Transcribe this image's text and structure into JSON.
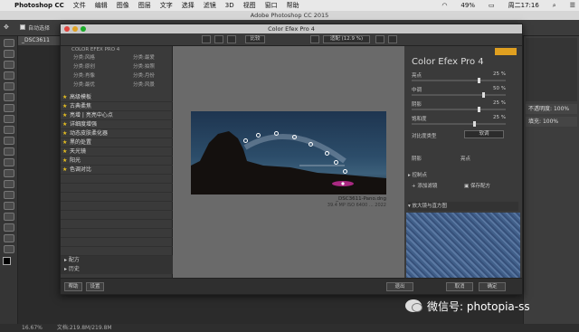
{
  "menubar": {
    "app_name": "Photoshop CC",
    "items": [
      "文件",
      "编辑",
      "图像",
      "图层",
      "文字",
      "选择",
      "滤镜",
      "3D",
      "视图",
      "窗口",
      "帮助"
    ],
    "battery": "49%",
    "clock": "周二17:16"
  },
  "ps_window": {
    "title": "Adobe Photoshop CC 2015",
    "auto_select_label": "自动选择",
    "doc_tab": "_DSC3611",
    "zoom_status": "16.67%",
    "doc_status": "文档:219.8M/219.8M"
  },
  "right_panels": {
    "opacity_label": "不透明度:",
    "opacity_value": "100%",
    "fill_label": "填充:",
    "fill_value": "100%"
  },
  "plugin": {
    "title": "Color Efex Pro 4",
    "toolbar_compare": "比较",
    "zoom_select": "适配 (12.9 %)",
    "categories": [
      "分类:风格",
      "分类:最爱",
      "分类:原创",
      "分类:拍照",
      "分类:肖像",
      "分类:月份",
      "分类:最优",
      "分类:风景"
    ],
    "header": "COLOR EFEX PRO 4",
    "filters": [
      "高级模板",
      "古典柔焦",
      "亮增 | 亮亮中心点",
      "详细度增强",
      "动态皮肤柔化器",
      "黑的处置",
      "天光镜",
      "阳光",
      "色调对比"
    ],
    "recipes_label": "配方",
    "history_label": "历史",
    "help_button": "帮助",
    "settings_button": "设置",
    "file_name": "_DSC3611-Pano.dng",
    "file_info": "39.4 MP ISO 6400 ... 2022",
    "brand_text": "Color Efex Pro",
    "brand_number": "4",
    "sliders": [
      {
        "label": "亮点",
        "value": "25 %"
      },
      {
        "label": "中调",
        "value": "50 %"
      },
      {
        "label": "阴影",
        "value": "25 %"
      },
      {
        "label": "饱和度",
        "value": "25 %"
      }
    ],
    "contrast_method_label": "对比度类型",
    "contrast_method_value": "软调",
    "shadow_label": "阴影",
    "highlight_label": "亮点",
    "control_points_label": "控制点",
    "add_filter_label": "添加滤镜",
    "save_recipe_label": "保存配方",
    "loupe_label": "放大镜与直方图",
    "cancel_left_button": "退出",
    "cancel_button": "取消",
    "ok_button": "确定"
  },
  "watermark": "微信号: photopia-ss",
  "colors": {
    "star": "#e8c020",
    "panel": "#3a3a3a",
    "preview_bg": "#6a6a6a"
  }
}
